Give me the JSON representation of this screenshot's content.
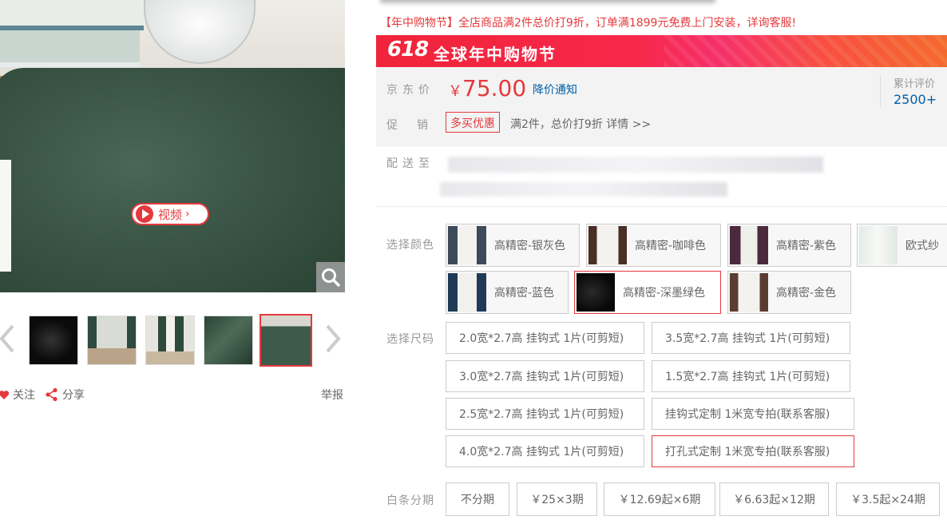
{
  "gallery": {
    "video_label": "视频",
    "zoom_icon": "magnifier-icon",
    "thumbnails": [
      {
        "name": "thumb-1",
        "active": false
      },
      {
        "name": "thumb-2",
        "active": false
      },
      {
        "name": "thumb-3",
        "active": false
      },
      {
        "name": "thumb-4",
        "active": false
      },
      {
        "name": "thumb-5",
        "active": true
      }
    ],
    "follow_label": "关注",
    "share_label": "分享",
    "report_label": "举报"
  },
  "product": {
    "promo_line": "【年中购物节】全店商品满2件总价打9折，订单满1899元免费上门安装，详询客服!",
    "banner_618": "618",
    "banner_text": "全球年中购物节",
    "price_label": "京东价",
    "currency": "￥",
    "price": "75.00",
    "price_notice": "降价通知",
    "reviews_label": "累计评价",
    "reviews_count": "2500+",
    "promo_label": "促销",
    "promo_tag": "多买优惠",
    "promo_desc": "满2件，总价打9折 详情 >>",
    "delivery_label": "配送至"
  },
  "colors": {
    "label": "选择颜色",
    "options": [
      {
        "label": "高精密-银灰色",
        "selected": false
      },
      {
        "label": "高精密-咖啡色",
        "selected": false
      },
      {
        "label": "高精密-紫色",
        "selected": false
      },
      {
        "label": "欧式纱",
        "selected": false
      },
      {
        "label": "高精密-蓝色",
        "selected": false
      },
      {
        "label": "高精密-深墨绿色",
        "selected": true
      },
      {
        "label": "高精密-金色",
        "selected": false
      }
    ]
  },
  "sizes": {
    "label": "选择尺码",
    "options": [
      {
        "label": "2.0宽*2.7高 挂钩式 1片(可剪短)",
        "selected": false
      },
      {
        "label": "3.5宽*2.7高 挂钩式 1片(可剪短)",
        "selected": false
      },
      {
        "label": "3.0宽*2.7高 挂钩式 1片(可剪短)",
        "selected": false
      },
      {
        "label": "1.5宽*2.7高 挂钩式 1片(可剪短)",
        "selected": false
      },
      {
        "label": "2.5宽*2.7高 挂钩式 1片(可剪短)",
        "selected": false
      },
      {
        "label": "挂钩式定制 1米宽专拍(联系客服)",
        "selected": false
      },
      {
        "label": "4.0宽*2.7高 挂钩式 1片(可剪短)",
        "selected": false
      },
      {
        "label": "打孔式定制 1米宽专拍(联系客服)",
        "selected": true
      }
    ]
  },
  "installments": {
    "label": "白条分期",
    "options": [
      "不分期",
      "￥25×3期",
      "￥12.69起×6期",
      "￥6.63起×12期",
      "￥3.5起×24期"
    ]
  },
  "colors_theme": {
    "accent": "#e4393c",
    "link": "#005ea7"
  }
}
